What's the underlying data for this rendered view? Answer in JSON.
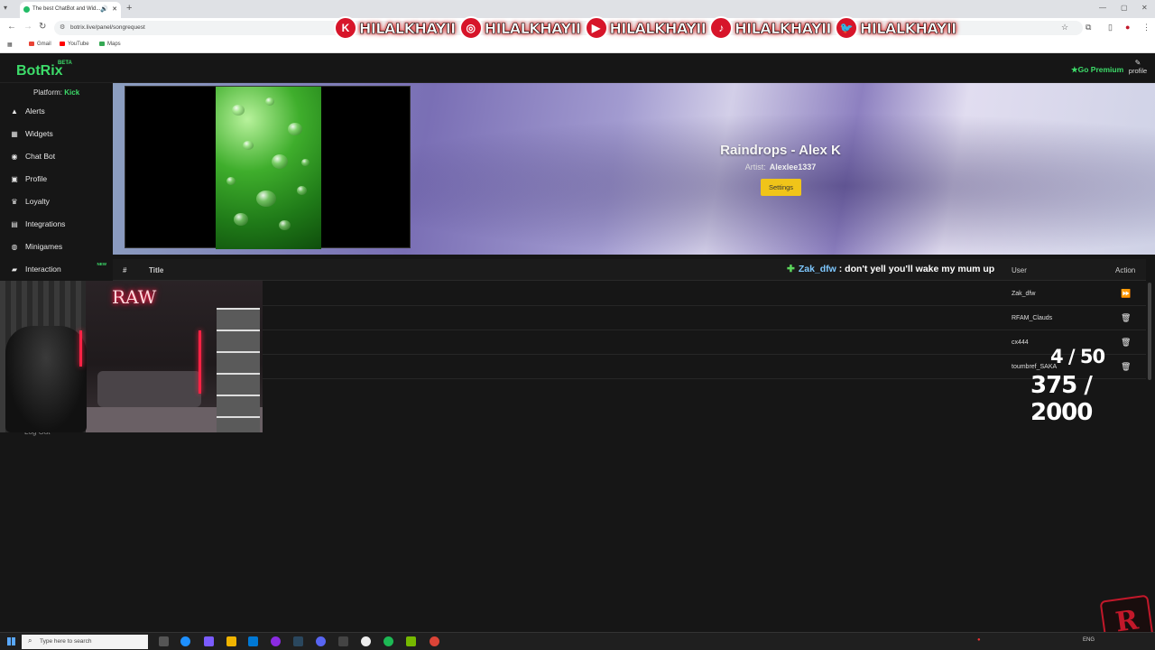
{
  "browser": {
    "tab_title": "The best ChatBot and Wid...",
    "url": "botrix.live/panel/songrequest",
    "bookmarks": [
      "Gmail",
      "YouTube",
      "Maps"
    ]
  },
  "social_banner": {
    "handles": [
      "HILALKHAYII",
      "HILALKHAYII",
      "HILALKHAYII",
      "HILALKHAYII",
      "HILALKHAYII"
    ],
    "icons": [
      "kick-icon",
      "instagram-icon",
      "youtube-icon",
      "tiktok-icon",
      "twitter-icon"
    ],
    "icon_glyphs": [
      "K",
      "◎",
      "▶",
      "♪",
      "🐦"
    ],
    "accent": "#d7152a"
  },
  "app": {
    "logo": "BotRix",
    "beta": "BETA",
    "premium": "Go Premium",
    "profile": "profile",
    "accent": "#3ddc6a"
  },
  "sidebar": {
    "platform_label": "Platform:",
    "platform_value": "Kick",
    "items": [
      {
        "label": "Alerts",
        "icon": "▲"
      },
      {
        "label": "Widgets",
        "icon": "▦"
      },
      {
        "label": "Chat Bot",
        "icon": "◉"
      },
      {
        "label": "Profile",
        "icon": "▣"
      },
      {
        "label": "Loyalty",
        "icon": "♛"
      },
      {
        "label": "Integrations",
        "icon": "▤"
      },
      {
        "label": "Minigames",
        "icon": "◍"
      },
      {
        "label": "Interaction",
        "icon": "▰"
      }
    ],
    "new_badge": "NEW",
    "logout": "Log Out"
  },
  "now_playing": {
    "title": "Raindrops - Alex K",
    "artist_label": "Artist:",
    "artist": "Alexlee1337",
    "settings": "Settings"
  },
  "queue": {
    "headers": {
      "num": "#",
      "title": "Title",
      "user": "User",
      "action": "Action"
    },
    "rows": [
      {
        "user": "Zak_dfw",
        "action_icon": "⏩"
      },
      {
        "user": "RFAM_Clauds",
        "action_icon": "🗑"
      },
      {
        "user": "cx444",
        "action_icon": "🗑"
      },
      {
        "user": "toumbref_SAKA",
        "action_icon": "🗑"
      }
    ]
  },
  "chat_overlay": {
    "user": "Zak_dfw",
    "message": ": don't yell you'll wake my mum up"
  },
  "counters": {
    "line1": "4 / 50",
    "line2": "375 / 2000"
  },
  "taskbar": {
    "search_placeholder": "Type here to search",
    "tray_lang": "ENG"
  }
}
